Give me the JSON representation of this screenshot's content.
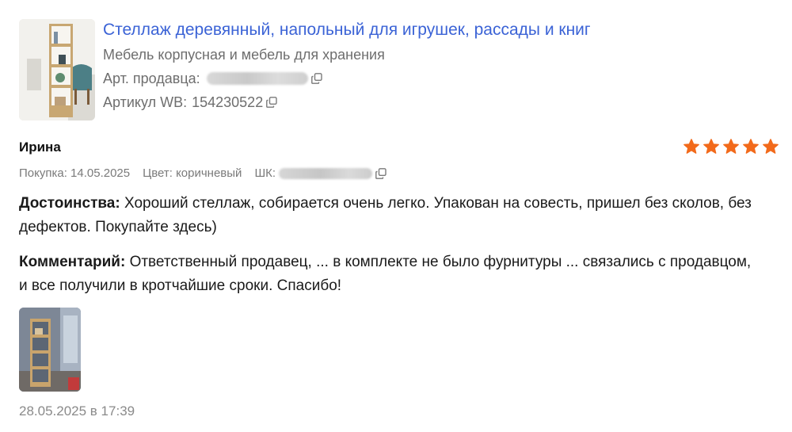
{
  "product": {
    "title": "Стеллаж деревянный, напольный для игрушек, рассады и книг",
    "category": "Мебель корпусная и мебель для хранения",
    "seller_article_label": "Арт. продавца:",
    "wb_article_label": "Артикул WB:",
    "wb_article_value": "154230522",
    "image_icon": "bookshelf-product-photo"
  },
  "review": {
    "author": "Ирина",
    "rating": 5,
    "purchase_label": "Покупка: 14.05.2025",
    "color_label": "Цвет: коричневый",
    "barcode_label": "ШК:",
    "pros_label": "Достоинства:",
    "pros_text": "Хороший стеллаж, собирается очень легко. Упакован на совесть, пришел без сколов, без дефектов. Покупайте здесь)",
    "comment_label": "Комментарий:",
    "comment_text": "Ответственный продавец, ... в комплекте не было фурнитуры ... связались с продавцом, и все получили в кротчайшие сроки. Спасибо!",
    "date": "28.05.2025 в 17:39",
    "photo_icon": "customer-photo-bookshelf"
  },
  "colors": {
    "link": "#3b63d6",
    "star": "#f26a1b",
    "muted": "#6e6e6e"
  }
}
